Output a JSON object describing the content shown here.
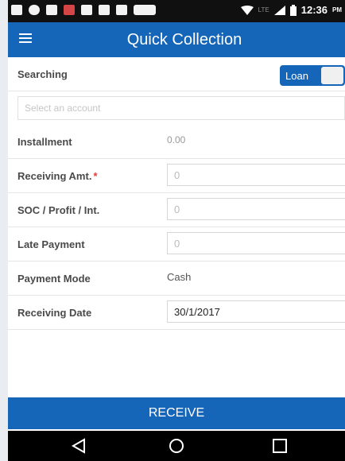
{
  "status": {
    "time": "12:36",
    "ampm": "PM",
    "network": "LTE"
  },
  "app_bar": {
    "title": "Quick Collection"
  },
  "search": {
    "label": "Searching",
    "toggle_label": "Loan"
  },
  "account": {
    "placeholder": "Select an account"
  },
  "fields": {
    "installment": {
      "label": "Installment",
      "value": "0.00"
    },
    "receiving_amt": {
      "label": "Receiving Amt.",
      "required": "*",
      "placeholder": "0"
    },
    "soc": {
      "label": "SOC / Profit / Int.",
      "placeholder": "0"
    },
    "late_payment": {
      "label": "Late Payment",
      "placeholder": "0"
    },
    "payment_mode": {
      "label": "Payment Mode",
      "value": "Cash"
    },
    "receiving_date": {
      "label": "Receiving Date",
      "value": "30/1/2017"
    }
  },
  "actions": {
    "receive_label": "RECEIVE"
  },
  "colors": {
    "primary": "#1565b8",
    "status_bar": "#101010",
    "nav_bar": "#000000",
    "required": "#e53935"
  }
}
